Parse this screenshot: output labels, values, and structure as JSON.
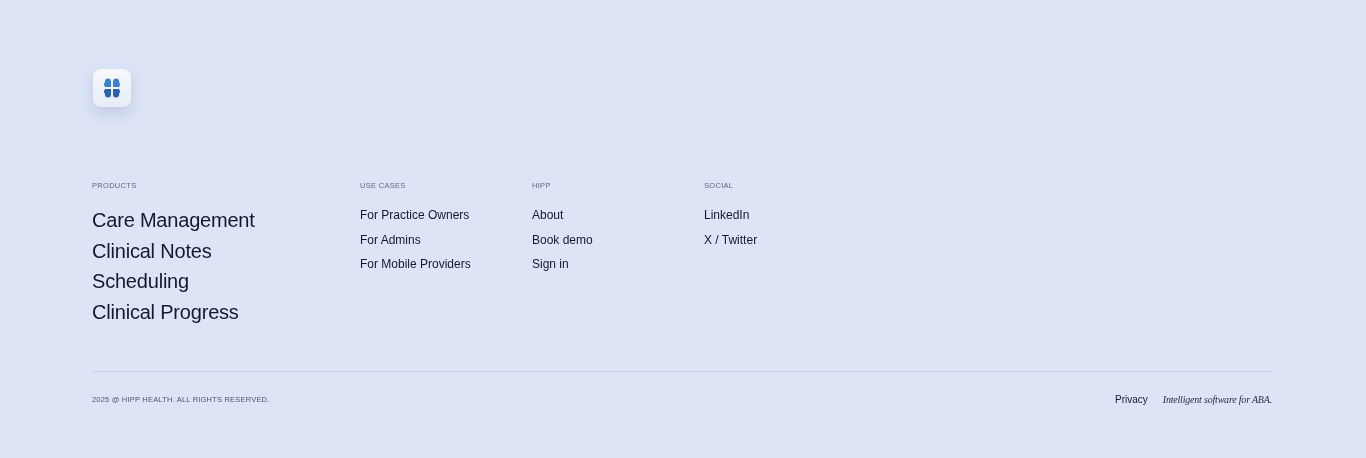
{
  "columns": [
    {
      "heading": "PRODUCTS",
      "kind": "large",
      "links": [
        "Care Management",
        "Clinical Notes",
        "Scheduling",
        "Clinical Progress"
      ]
    },
    {
      "heading": "USE CASES",
      "kind": "small",
      "links": [
        "For Practice Owners",
        "For Admins",
        "For Mobile Providers"
      ]
    },
    {
      "heading": "HIPP",
      "kind": "small",
      "links": [
        "About",
        "Book demo",
        "Sign in"
      ]
    },
    {
      "heading": "SOCIAL",
      "kind": "small",
      "links": [
        "LinkedIn",
        "X / Twitter"
      ]
    }
  ],
  "copyright": "2025 @ HIPP HEALTH. ALL RIGHTS RESERVED.",
  "privacy_link": "Privacy",
  "tagline": "Intelligent software for ABA."
}
